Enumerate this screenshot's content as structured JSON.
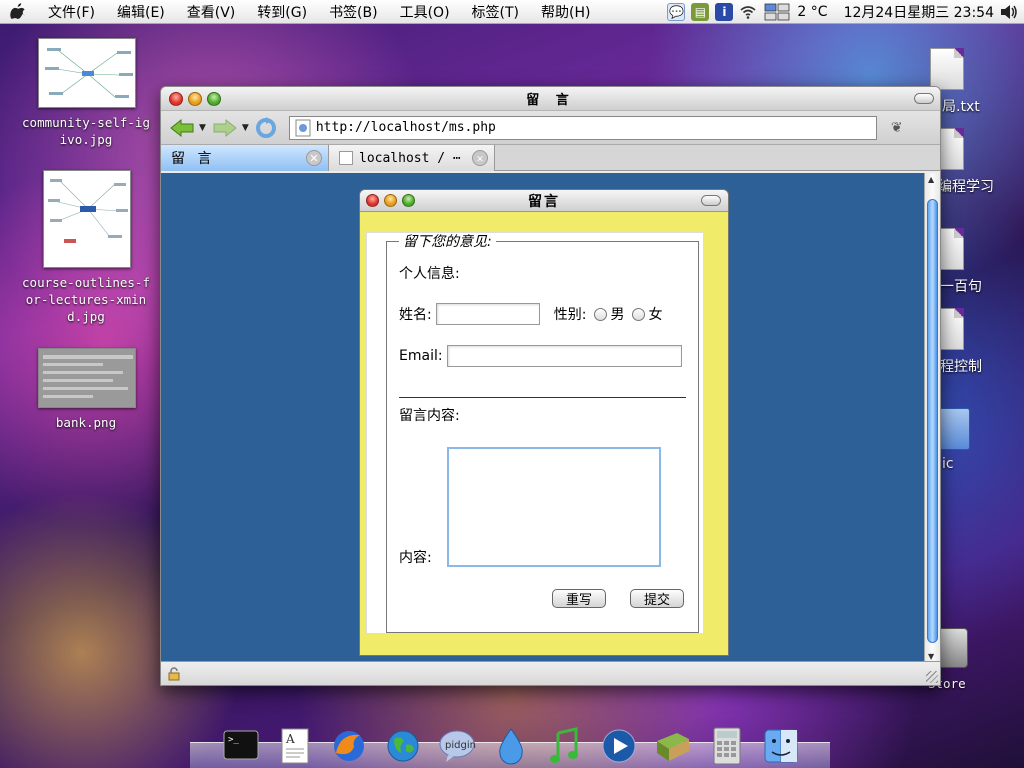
{
  "menubar": {
    "items": [
      "文件(F)",
      "编辑(E)",
      "查看(V)",
      "转到(G)",
      "书签(B)",
      "工具(O)",
      "标签(T)",
      "帮助(H)"
    ],
    "temperature": "2 °C",
    "datetime": "12月24日星期三 23:54"
  },
  "desktop": {
    "icons": [
      {
        "label": "community-self-igivo.jpg"
      },
      {
        "label": "course-outlines-for-lectures-xmind.jpg"
      },
      {
        "label": "bank.png"
      }
    ],
    "right_labels": [
      "局.txt",
      "编程学习",
      "一百句",
      "程控制",
      "ic",
      "Store"
    ]
  },
  "browser": {
    "title": "留 言",
    "url": "http://localhost/ms.php",
    "tabs": [
      {
        "label": "留 言",
        "active": true
      },
      {
        "label": "localhost / ⋯",
        "active": false
      }
    ]
  },
  "page": {
    "window_title": "留言",
    "legend": "留下您的意见:",
    "personal_info": "个人信息:",
    "name_label": "姓名:",
    "gender_label": "性别:",
    "gender_male": "男",
    "gender_female": "女",
    "email_label": "Email:",
    "message_heading": "留言内容:",
    "content_label": "内容:",
    "reset_button": "重写",
    "submit_button": "提交"
  },
  "dock": {
    "items": [
      "terminal-icon",
      "text-editor-icon",
      "firefox-icon",
      "earth-browser-icon",
      "pidgin-chat-icon",
      "water-drop-icon",
      "music-note-icon",
      "media-player-icon",
      "books-icon",
      "calculator-icon",
      "finder-icon"
    ]
  },
  "colors": {
    "page_background": "#2d6096",
    "inner_window": "#f0ec6a",
    "active_tab": "#8fc0f3"
  }
}
